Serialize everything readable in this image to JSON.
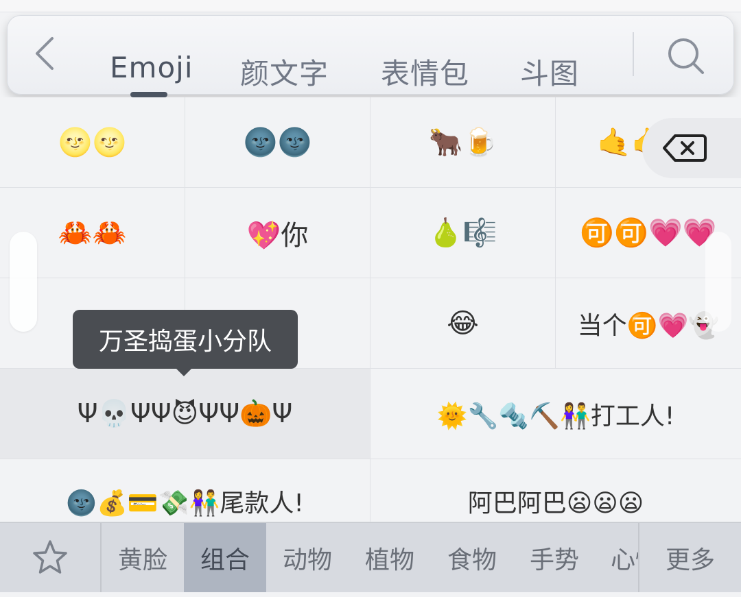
{
  "tabs": [
    {
      "label": "Emoji",
      "active": true
    },
    {
      "label": "颜文字"
    },
    {
      "label": "表情包"
    },
    {
      "label": "斗图"
    }
  ],
  "icons": {
    "back": "chevron-left-icon",
    "search": "search-icon",
    "delete": "backspace-icon",
    "favorites": "star-icon"
  },
  "grid": {
    "rows": [
      [
        "🌝🌝",
        "🌚🌚",
        "🐂🍺",
        "🤙🤙🤙"
      ],
      [
        "🦀🦀",
        "💖你",
        "🍐🎼",
        "🉑🉑💗💗"
      ],
      [
        "",
        "",
        "😂",
        "当个🉑💗👻"
      ],
      [
        "Ψ💀ΨΨ😈ΨΨ🎃Ψ",
        "🌞🔧🔩⛏️👫打工人!"
      ],
      [
        "🌚💰💳💸👫尾款人!",
        "阿巴阿巴😦😦😦"
      ]
    ]
  },
  "tooltip": {
    "text": "万圣捣蛋小分队"
  },
  "categories": [
    {
      "label": "黄脸"
    },
    {
      "label": "组合",
      "active": true
    },
    {
      "label": "动物"
    },
    {
      "label": "植物"
    },
    {
      "label": "食物"
    },
    {
      "label": "手势"
    },
    {
      "label": "心情"
    }
  ],
  "more_label": "更多",
  "colors": {
    "active_tab_text": "#4c5462",
    "tab_text": "#707785",
    "tooltip_bg": "#4a4d52",
    "active_category_bg": "#aeb5c1",
    "category_bar_bg": "#d7dae0"
  }
}
